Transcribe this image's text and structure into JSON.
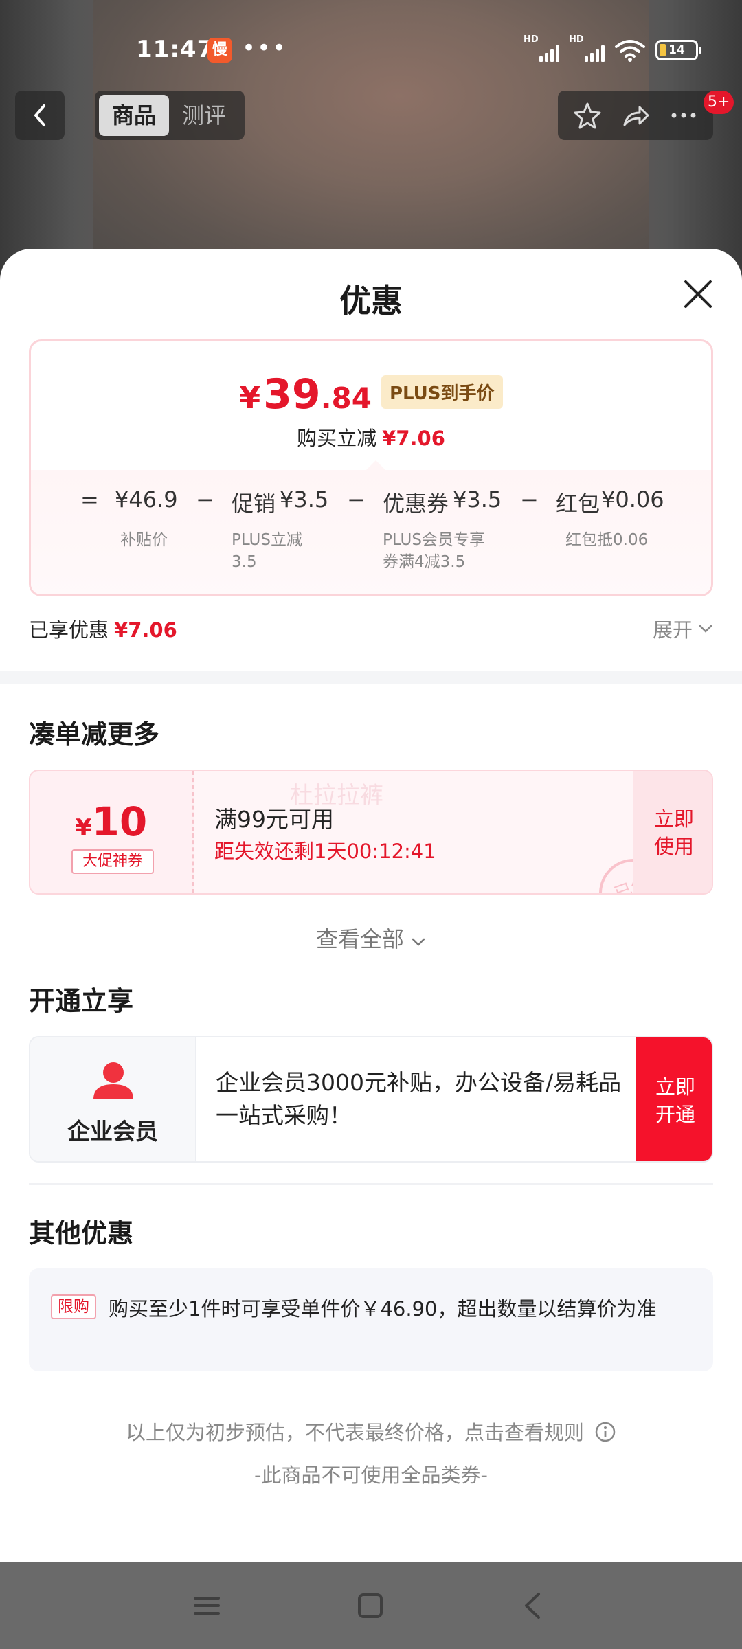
{
  "status_bar": {
    "time": "11:47",
    "app_icon_glyph": "慢",
    "dots": "•••",
    "signal_label_1": "HD",
    "signal_label_2": "HD",
    "battery": "14"
  },
  "top_nav": {
    "tabs": [
      {
        "label": "商品",
        "active": true
      },
      {
        "label": "测评",
        "active": false
      }
    ],
    "badge": "5+"
  },
  "sheet": {
    "title": "优惠",
    "price": {
      "yen": "¥",
      "integer": "39",
      "decimal": ".84",
      "plus_tag": "PLUS到手价",
      "sub_label": "购买立减",
      "sub_value": "¥7.06"
    },
    "breakdown": {
      "equals": "=",
      "base_value": "¥46.9",
      "base_label": "补贴价",
      "minus": "−",
      "items": [
        {
          "name": "促销",
          "value": "¥3.5",
          "label_line1": "PLUS立减",
          "label_line2": "3.5"
        },
        {
          "name": "优惠券",
          "value": "¥3.5",
          "label_line1": "PLUS会员专享",
          "label_line2": "券满4减3.5"
        },
        {
          "name": "红包",
          "value": "¥0.06",
          "label_line1": "红包抵0.06",
          "label_line2": ""
        }
      ]
    },
    "saved": {
      "label": "已享优惠",
      "value": "¥7.06"
    },
    "expand": "展开",
    "section_more": "凑单减更多",
    "coupon": {
      "yen": "¥",
      "amount": "10",
      "tag": "大促神券",
      "condition": "满99元可用",
      "expire": "距失效还剩1天00:12:41",
      "watermark": "杜拉拉裤",
      "stamp": "已领",
      "btn_line1": "立即",
      "btn_line2": "使用"
    },
    "view_all": "查看全部",
    "section_open": "开通立享",
    "member": {
      "name": "企业会员",
      "desc": "企业会员3000元补贴，办公设备/易耗品一站式采购！",
      "btn_line1": "立即",
      "btn_line2": "开通"
    },
    "section_other": "其他优惠",
    "other": {
      "tag": "限购",
      "text": "购买至少1件时可享受单件价￥46.90，超出数量以结算价为准"
    },
    "note": "以上仅为初步预估，不代表最终价格，点击查看规则",
    "note2": "-此商品不可使用全品类券-"
  },
  "colors": {
    "accent_red": "#e4172b",
    "plus_gold_bg": "#fbebc9",
    "open_btn_red": "#f5122b"
  },
  "icons": [
    "back-chevron-icon",
    "star-icon",
    "share-icon",
    "more-icon",
    "close-icon",
    "chevron-down-icon",
    "person-icon",
    "info-icon",
    "menu-icon",
    "home-square-icon",
    "back-triangle-icon"
  ]
}
